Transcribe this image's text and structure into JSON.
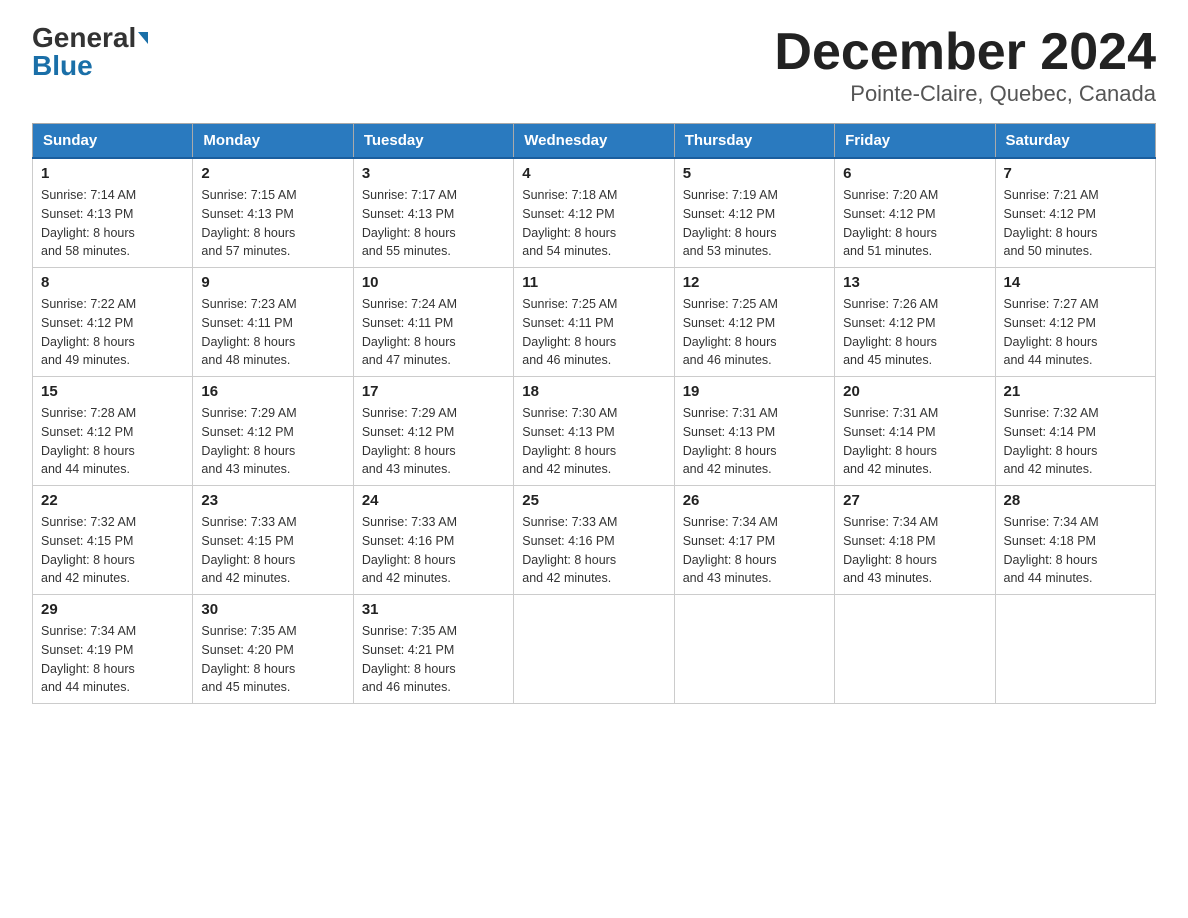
{
  "header": {
    "logo_general": "General",
    "logo_blue": "Blue",
    "title": "December 2024",
    "subtitle": "Pointe-Claire, Quebec, Canada"
  },
  "columns": [
    "Sunday",
    "Monday",
    "Tuesday",
    "Wednesday",
    "Thursday",
    "Friday",
    "Saturday"
  ],
  "weeks": [
    [
      {
        "day": "1",
        "sunrise": "7:14 AM",
        "sunset": "4:13 PM",
        "daylight": "8 hours and 58 minutes."
      },
      {
        "day": "2",
        "sunrise": "7:15 AM",
        "sunset": "4:13 PM",
        "daylight": "8 hours and 57 minutes."
      },
      {
        "day": "3",
        "sunrise": "7:17 AM",
        "sunset": "4:13 PM",
        "daylight": "8 hours and 55 minutes."
      },
      {
        "day": "4",
        "sunrise": "7:18 AM",
        "sunset": "4:12 PM",
        "daylight": "8 hours and 54 minutes."
      },
      {
        "day": "5",
        "sunrise": "7:19 AM",
        "sunset": "4:12 PM",
        "daylight": "8 hours and 53 minutes."
      },
      {
        "day": "6",
        "sunrise": "7:20 AM",
        "sunset": "4:12 PM",
        "daylight": "8 hours and 51 minutes."
      },
      {
        "day": "7",
        "sunrise": "7:21 AM",
        "sunset": "4:12 PM",
        "daylight": "8 hours and 50 minutes."
      }
    ],
    [
      {
        "day": "8",
        "sunrise": "7:22 AM",
        "sunset": "4:12 PM",
        "daylight": "8 hours and 49 minutes."
      },
      {
        "day": "9",
        "sunrise": "7:23 AM",
        "sunset": "4:11 PM",
        "daylight": "8 hours and 48 minutes."
      },
      {
        "day": "10",
        "sunrise": "7:24 AM",
        "sunset": "4:11 PM",
        "daylight": "8 hours and 47 minutes."
      },
      {
        "day": "11",
        "sunrise": "7:25 AM",
        "sunset": "4:11 PM",
        "daylight": "8 hours and 46 minutes."
      },
      {
        "day": "12",
        "sunrise": "7:25 AM",
        "sunset": "4:12 PM",
        "daylight": "8 hours and 46 minutes."
      },
      {
        "day": "13",
        "sunrise": "7:26 AM",
        "sunset": "4:12 PM",
        "daylight": "8 hours and 45 minutes."
      },
      {
        "day": "14",
        "sunrise": "7:27 AM",
        "sunset": "4:12 PM",
        "daylight": "8 hours and 44 minutes."
      }
    ],
    [
      {
        "day": "15",
        "sunrise": "7:28 AM",
        "sunset": "4:12 PM",
        "daylight": "8 hours and 44 minutes."
      },
      {
        "day": "16",
        "sunrise": "7:29 AM",
        "sunset": "4:12 PM",
        "daylight": "8 hours and 43 minutes."
      },
      {
        "day": "17",
        "sunrise": "7:29 AM",
        "sunset": "4:12 PM",
        "daylight": "8 hours and 43 minutes."
      },
      {
        "day": "18",
        "sunrise": "7:30 AM",
        "sunset": "4:13 PM",
        "daylight": "8 hours and 42 minutes."
      },
      {
        "day": "19",
        "sunrise": "7:31 AM",
        "sunset": "4:13 PM",
        "daylight": "8 hours and 42 minutes."
      },
      {
        "day": "20",
        "sunrise": "7:31 AM",
        "sunset": "4:14 PM",
        "daylight": "8 hours and 42 minutes."
      },
      {
        "day": "21",
        "sunrise": "7:32 AM",
        "sunset": "4:14 PM",
        "daylight": "8 hours and 42 minutes."
      }
    ],
    [
      {
        "day": "22",
        "sunrise": "7:32 AM",
        "sunset": "4:15 PM",
        "daylight": "8 hours and 42 minutes."
      },
      {
        "day": "23",
        "sunrise": "7:33 AM",
        "sunset": "4:15 PM",
        "daylight": "8 hours and 42 minutes."
      },
      {
        "day": "24",
        "sunrise": "7:33 AM",
        "sunset": "4:16 PM",
        "daylight": "8 hours and 42 minutes."
      },
      {
        "day": "25",
        "sunrise": "7:33 AM",
        "sunset": "4:16 PM",
        "daylight": "8 hours and 42 minutes."
      },
      {
        "day": "26",
        "sunrise": "7:34 AM",
        "sunset": "4:17 PM",
        "daylight": "8 hours and 43 minutes."
      },
      {
        "day": "27",
        "sunrise": "7:34 AM",
        "sunset": "4:18 PM",
        "daylight": "8 hours and 43 minutes."
      },
      {
        "day": "28",
        "sunrise": "7:34 AM",
        "sunset": "4:18 PM",
        "daylight": "8 hours and 44 minutes."
      }
    ],
    [
      {
        "day": "29",
        "sunrise": "7:34 AM",
        "sunset": "4:19 PM",
        "daylight": "8 hours and 44 minutes."
      },
      {
        "day": "30",
        "sunrise": "7:35 AM",
        "sunset": "4:20 PM",
        "daylight": "8 hours and 45 minutes."
      },
      {
        "day": "31",
        "sunrise": "7:35 AM",
        "sunset": "4:21 PM",
        "daylight": "8 hours and 46 minutes."
      },
      null,
      null,
      null,
      null
    ]
  ],
  "labels": {
    "sunrise": "Sunrise:",
    "sunset": "Sunset:",
    "daylight": "Daylight:"
  }
}
